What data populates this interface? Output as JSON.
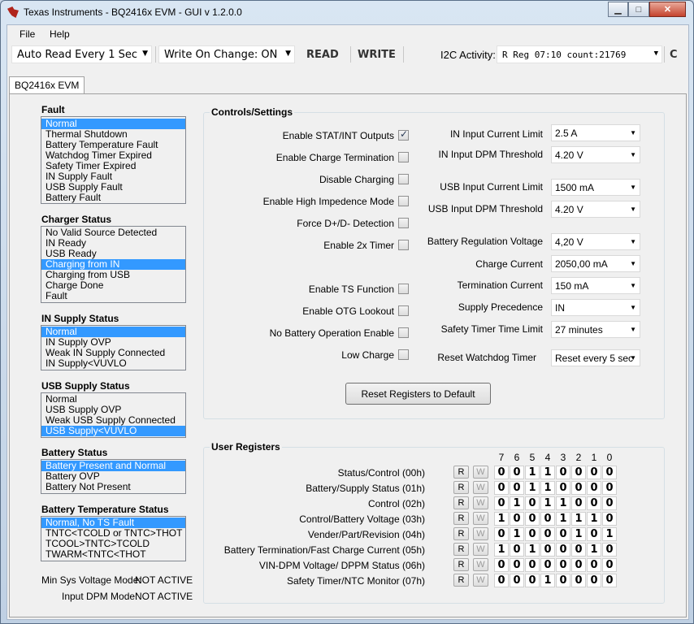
{
  "window": {
    "title": "Texas Instruments - BQ2416x EVM - GUI v 1.2.0.0",
    "min": "▁",
    "max": "□",
    "close": "✕"
  },
  "menu": {
    "file": "File",
    "help": "Help"
  },
  "toolbar": {
    "auto_read": "Auto Read Every 1 Sec",
    "write_on_change": "Write On Change: ON",
    "read": "READ",
    "write": "WRITE",
    "i2c_label": "I2C Activity:",
    "i2c_value": "R Reg 07:10  count:21769",
    "c": "C"
  },
  "tab": "BQ2416x EVM",
  "fault": {
    "title": "Fault",
    "items": [
      "Normal",
      "Thermal Shutdown",
      "Battery Temperature Fault",
      "Watchdog Timer Expired",
      "Safety Timer Expired",
      "IN Supply Fault",
      "USB Supply Fault",
      "Battery Fault"
    ]
  },
  "charger": {
    "title": "Charger Status",
    "items": [
      "No Valid Source Detected",
      "IN Ready",
      "USB Ready",
      "Charging from IN",
      "Charging from USB",
      "Charge Done",
      "Fault"
    ]
  },
  "in_supply": {
    "title": "IN Supply Status",
    "items": [
      "Normal",
      "IN Supply OVP",
      "Weak IN Supply Connected",
      "IN Supply<VUVLO"
    ]
  },
  "usb_supply": {
    "title": "USB Supply Status",
    "items": [
      "Normal",
      "USB Supply OVP",
      "Weak USB Supply Connected",
      "USB Supply<VUVLO"
    ]
  },
  "battery": {
    "title": "Battery Status",
    "items": [
      "Battery Present and Normal",
      "Battery OVP",
      "Battery Not Present"
    ]
  },
  "battemp": {
    "title": "Battery Temperature Status",
    "items": [
      "Normal, No TS Fault",
      "TNTC<TCOLD or TNTC>THOT",
      "TCOOL>TNTC>TCOLD",
      "TWARM<TNTC<THOT"
    ]
  },
  "modes": {
    "min_sys_label": "Min Sys Voltage Mode:",
    "min_sys_value": "NOT ACTIVE",
    "input_dpm_label": "Input DPM Mode:",
    "input_dpm_value": "NOT ACTIVE"
  },
  "controls": {
    "title": "Controls/Settings",
    "checks": [
      "Enable STAT/INT Outputs",
      "Enable Charge Termination",
      "Disable Charging",
      "Enable High Impedence Mode",
      "Force D+/D- Detection",
      "Enable 2x Timer",
      "Enable TS Function",
      "Enable OTG Lookout",
      "No Battery Operation Enable",
      "Low Charge"
    ],
    "settings": [
      {
        "label": "IN Input Current Limit",
        "value": "2.5 A"
      },
      {
        "label": "IN Input DPM Threshold",
        "value": "4.20 V"
      },
      {
        "label": "USB Input Current Limit",
        "value": "1500 mA"
      },
      {
        "label": "USB Input DPM Threshold",
        "value": "4.20 V"
      },
      {
        "label": "Battery Regulation Voltage",
        "value": "4,20 V"
      },
      {
        "label": "Charge Current",
        "value": "2050,00 mA"
      },
      {
        "label": "Termination Current",
        "value": "150 mA"
      },
      {
        "label": "Supply Precedence",
        "value": "IN"
      },
      {
        "label": "Safety Timer Time Limit",
        "value": "27 minutes"
      },
      {
        "label": "Reset Watchdog Timer",
        "value": "Reset every 5 sec"
      }
    ],
    "reset_button": "Reset Registers to Default"
  },
  "registers": {
    "title": "User Registers",
    "bit_headers": [
      "7",
      "6",
      "5",
      "4",
      "3",
      "2",
      "1",
      "0"
    ],
    "r": "R",
    "w": "W",
    "rows": [
      {
        "name": "Status/Control  (00h)",
        "bits": [
          "0",
          "0",
          "1",
          "1",
          "0",
          "0",
          "0",
          "0"
        ]
      },
      {
        "name": "Battery/Supply Status  (01h)",
        "bits": [
          "0",
          "0",
          "1",
          "1",
          "0",
          "0",
          "0",
          "0"
        ]
      },
      {
        "name": "Control  (02h)",
        "bits": [
          "0",
          "1",
          "0",
          "1",
          "1",
          "0",
          "0",
          "0"
        ]
      },
      {
        "name": "Control/Battery Voltage  (03h)",
        "bits": [
          "1",
          "0",
          "0",
          "0",
          "1",
          "1",
          "1",
          "0"
        ]
      },
      {
        "name": "Vender/Part/Revision  (04h)",
        "bits": [
          "0",
          "1",
          "0",
          "0",
          "0",
          "1",
          "0",
          "1"
        ]
      },
      {
        "name": "Battery Termination/Fast Charge Current  (05h)",
        "bits": [
          "1",
          "0",
          "1",
          "0",
          "0",
          "0",
          "1",
          "0"
        ]
      },
      {
        "name": "VIN-DPM Voltage/ DPPM Status  (06h)",
        "bits": [
          "0",
          "0",
          "0",
          "0",
          "0",
          "0",
          "0",
          "0"
        ]
      },
      {
        "name": "Safety Timer/NTC Monitor  (07h)",
        "bits": [
          "0",
          "0",
          "0",
          "1",
          "0",
          "0",
          "0",
          "0"
        ]
      }
    ]
  }
}
